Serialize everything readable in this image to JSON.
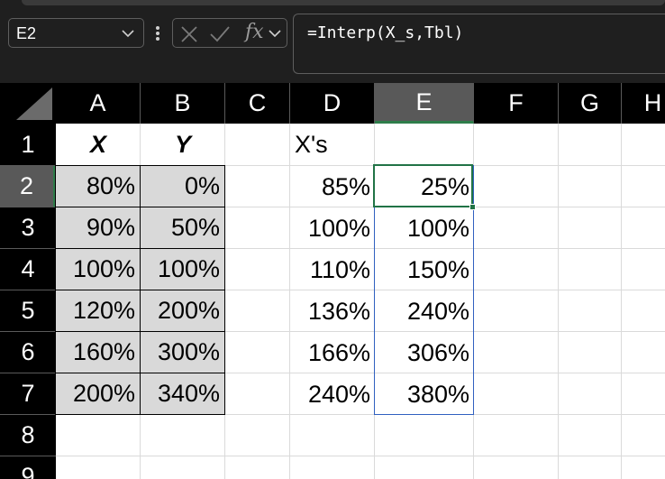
{
  "name_box": {
    "value": "E2"
  },
  "formula_bar": {
    "value": "=Interp(X_s,Tbl)"
  },
  "columns": [
    "A",
    "B",
    "C",
    "D",
    "E",
    "F",
    "G",
    "H"
  ],
  "selected_column": "E",
  "rows": [
    "1",
    "2",
    "3",
    "4",
    "5",
    "6",
    "7",
    "8",
    "9"
  ],
  "selected_row": "2",
  "table_headers": {
    "x": "X",
    "y": "Y"
  },
  "table_x": [
    "80%",
    "90%",
    "100%",
    "120%",
    "160%",
    "200%"
  ],
  "table_y": [
    "0%",
    "50%",
    "100%",
    "200%",
    "300%",
    "340%"
  ],
  "xs_header": "X's",
  "xs_values": [
    "85%",
    "100%",
    "110%",
    "136%",
    "166%",
    "240%"
  ],
  "results": [
    "25%",
    "100%",
    "150%",
    "240%",
    "306%",
    "380%"
  ],
  "active_cell": "E2",
  "colors": {
    "table_fill": "#d9d9d9",
    "selection_green": "#217346",
    "range_outline": "#3060c0"
  }
}
